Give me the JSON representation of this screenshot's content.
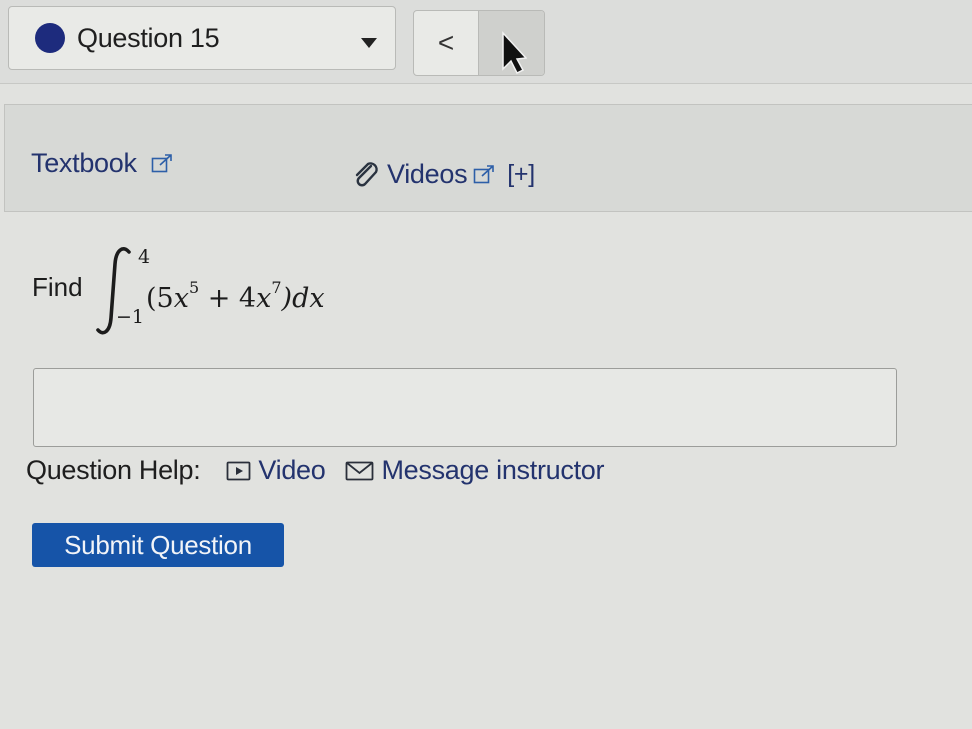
{
  "header": {
    "question_select": {
      "label": "Question 15",
      "status": "unanswered"
    },
    "nav": {
      "prev_label": "<"
    }
  },
  "resources": {
    "textbook_label": "Textbook",
    "videos_label": "Videos",
    "expand_label": "[+]"
  },
  "problem": {
    "prompt": "Find",
    "integral": {
      "lower_limit": "−1",
      "upper_limit": "4",
      "integrand_open": "(5",
      "var1": "x",
      "exp1": "5",
      "plus": " + 4",
      "var2": "x",
      "exp2": "7",
      "close_dx": ")dx"
    }
  },
  "answer": {
    "value": "",
    "placeholder": ""
  },
  "question_help": {
    "label": "Question Help:",
    "video_label": "Video",
    "message_label": "Message instructor"
  },
  "submit": {
    "label": "Submit Question"
  },
  "colors": {
    "accent": "#1654a8",
    "link": "#23336e",
    "status_dot": "#1d2b7d"
  }
}
